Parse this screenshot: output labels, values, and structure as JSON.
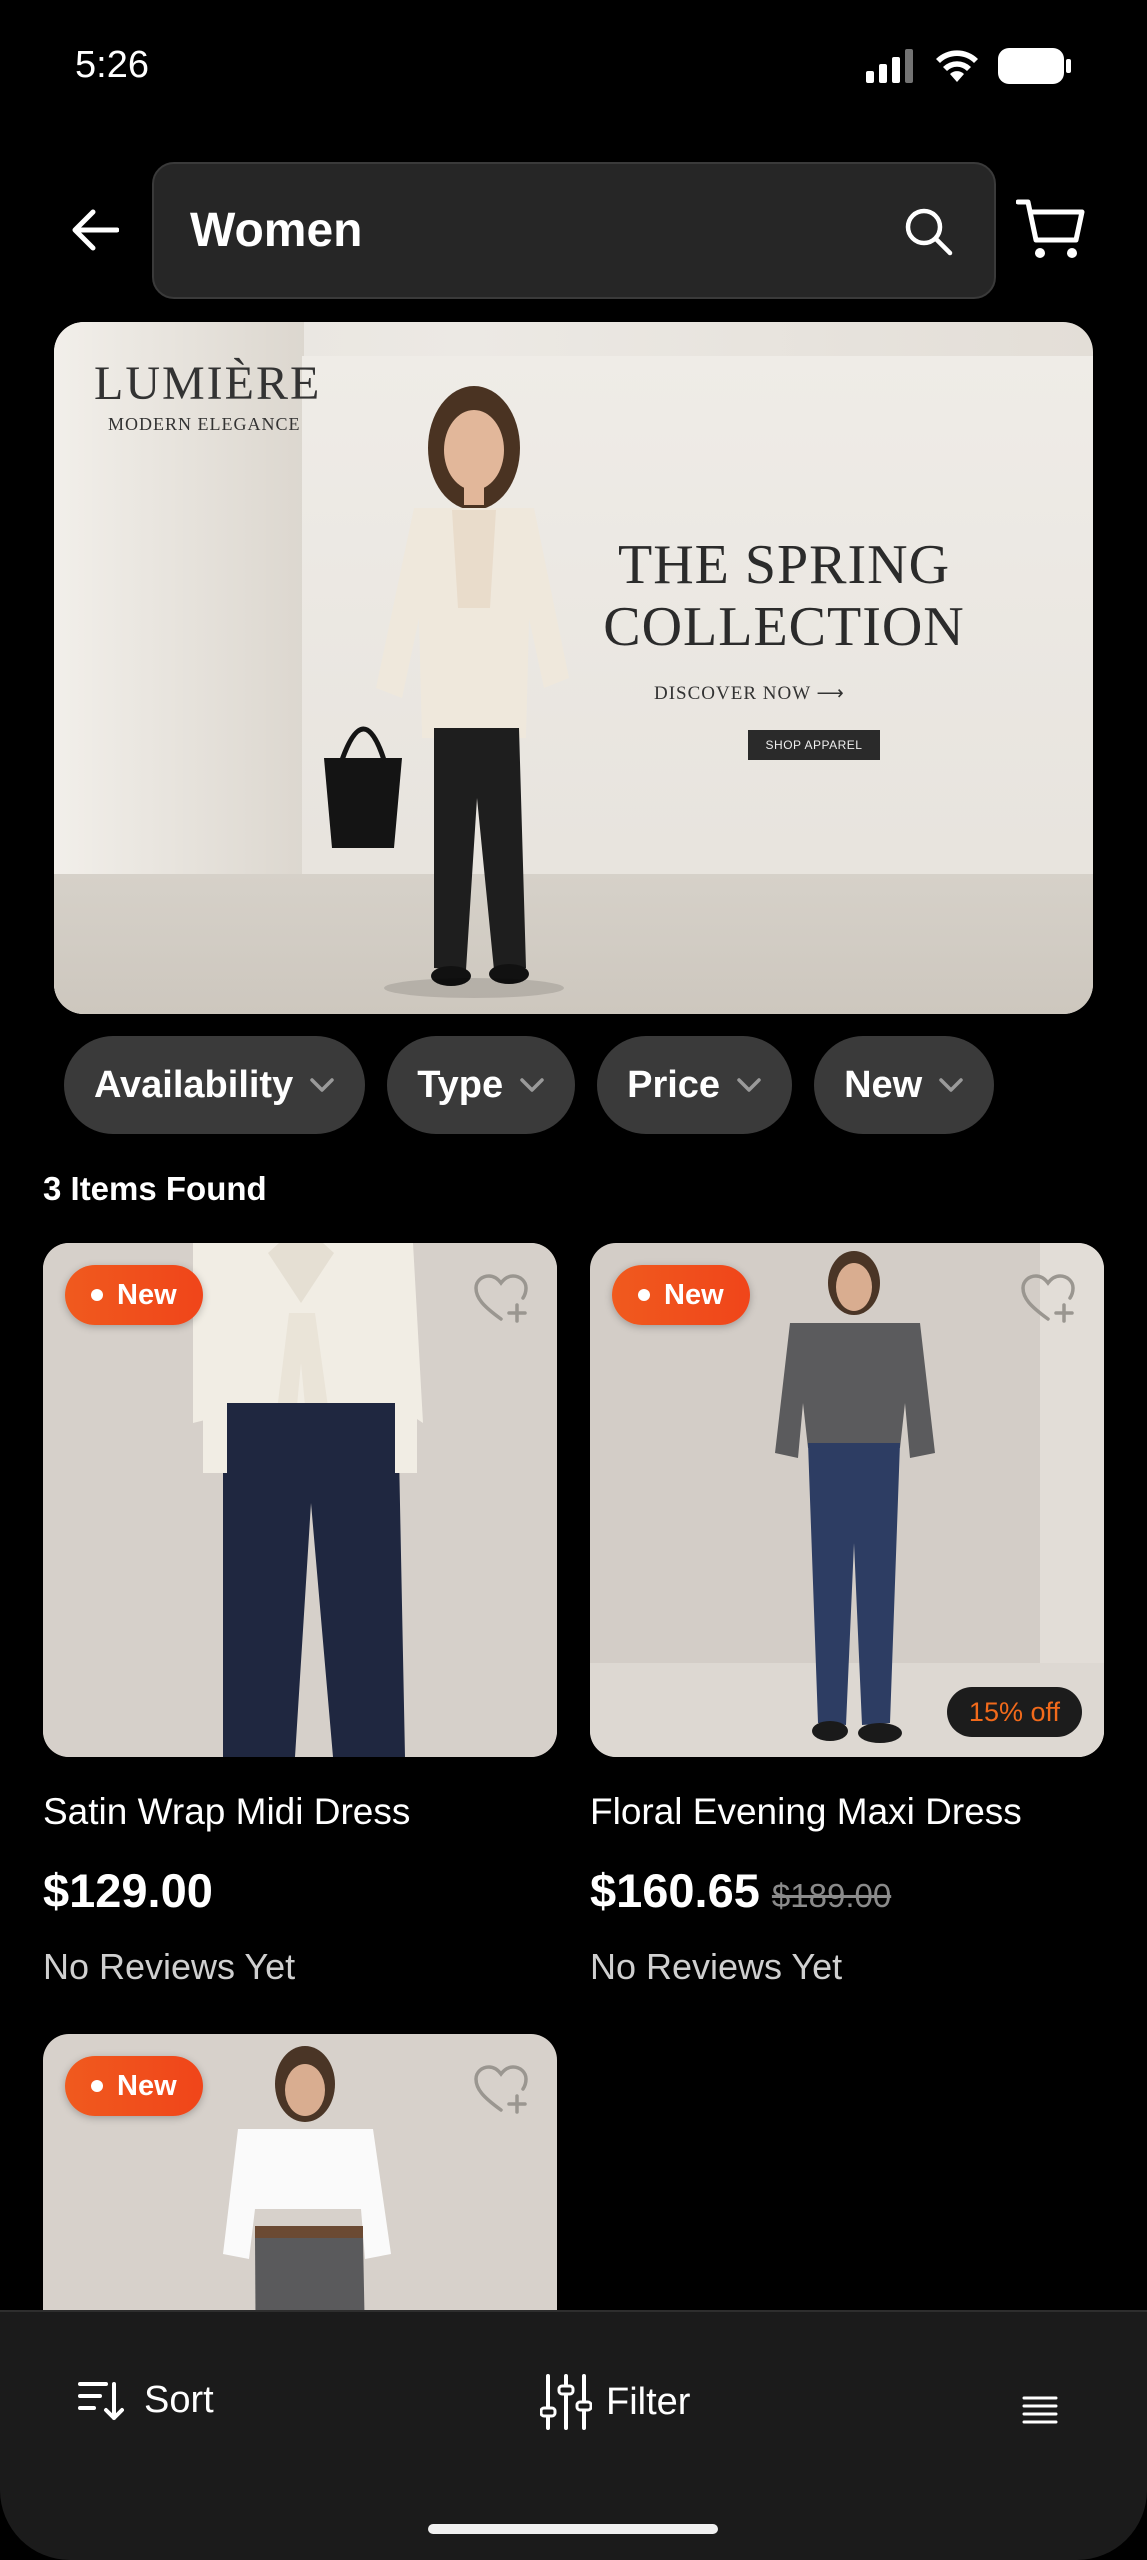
{
  "status_bar": {
    "time": "5:26",
    "icons": [
      "signal-icon",
      "wifi-icon",
      "battery-icon"
    ]
  },
  "header": {
    "search_value": "Women",
    "back_icon": "arrow-left-icon",
    "search_icon": "search-icon",
    "cart_icon": "cart-icon"
  },
  "banner": {
    "brand": "LUMIÈRE",
    "tagline": "MODERN ELEGANCE",
    "heading_line1": "THE SPRING",
    "heading_line2": "COLLECTION",
    "discover": "DISCOVER NOW ⟶",
    "shop_button": "SHOP APPAREL"
  },
  "filters": [
    {
      "label": "Availability"
    },
    {
      "label": "Type"
    },
    {
      "label": "Price"
    },
    {
      "label": "New"
    }
  ],
  "results": {
    "count_text": "3 Items Found"
  },
  "products": [
    {
      "badge": "New",
      "title": "Satin Wrap Midi Dress",
      "price": "$129.00",
      "old_price": "",
      "discount": "",
      "reviews": "No Reviews Yet"
    },
    {
      "badge": "New",
      "title": "Floral Evening Maxi Dress",
      "price": "$160.65",
      "old_price": "$189.00",
      "discount": "15% off",
      "reviews": "No Reviews Yet"
    },
    {
      "badge": "New",
      "title": "",
      "price": "",
      "old_price": "",
      "discount": "",
      "reviews": ""
    }
  ],
  "bottom_bar": {
    "sort_label": "Sort",
    "filter_label": "Filter",
    "view_icon": "list-view-icon"
  },
  "colors": {
    "accent": "#f05a1e",
    "background": "#000000",
    "chip": "#3a3a3a",
    "bar": "#1b1b1b"
  }
}
